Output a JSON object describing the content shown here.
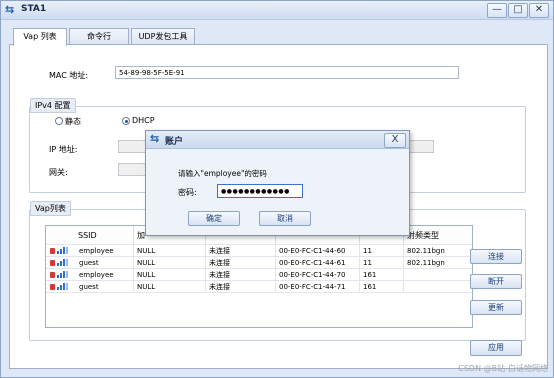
{
  "window": {
    "title": "STA1",
    "minimize": "—",
    "maximize": "□",
    "close": "✕"
  },
  "tabs": [
    "Vap 列表",
    "命令行",
    "UDP发包工具"
  ],
  "mac": {
    "label": "MAC 地址:",
    "value": "54-89-98-5F-5E-91"
  },
  "ipv4": {
    "group_title": "IPv4 配置",
    "static_label": "静态",
    "dhcp_label": "DHCP",
    "ip_label": "IP 地址:",
    "gateway_label": "网关:"
  },
  "vap": {
    "group_title": "Vap列表",
    "columns": [
      "SSID",
      "加",
      "",
      "",
      "",
      "射频类型"
    ],
    "rows": [
      [
        "employee",
        "NULL",
        "未连接",
        "00-E0-FC-C1-44-60",
        "11",
        "802.11bgn"
      ],
      [
        "guest",
        "NULL",
        "未连接",
        "00-E0-FC-C1-44-61",
        "11",
        "802.11bgn"
      ],
      [
        "employee",
        "NULL",
        "未连接",
        "00-E0-FC-C1-44-70",
        "161",
        ""
      ],
      [
        "guest",
        "NULL",
        "未连接",
        "00-E0-FC-C1-44-71",
        "161",
        ""
      ]
    ],
    "connect": "连接",
    "disconnect": "断开",
    "refresh": "更新"
  },
  "apply": "应用",
  "dialog": {
    "title": "账户",
    "close": "X",
    "prompt": "请输入\"employee\"的密码",
    "password_label": "密码:",
    "password_value": "●●●●●●●●●●●●",
    "ok": "确定",
    "cancel": "取消"
  },
  "watermark": "CSDN @B站-白话物网络",
  "colors": {
    "accent": "#1f5fb0",
    "lock": "#d23a3a",
    "signal": "#2d6fd0"
  }
}
